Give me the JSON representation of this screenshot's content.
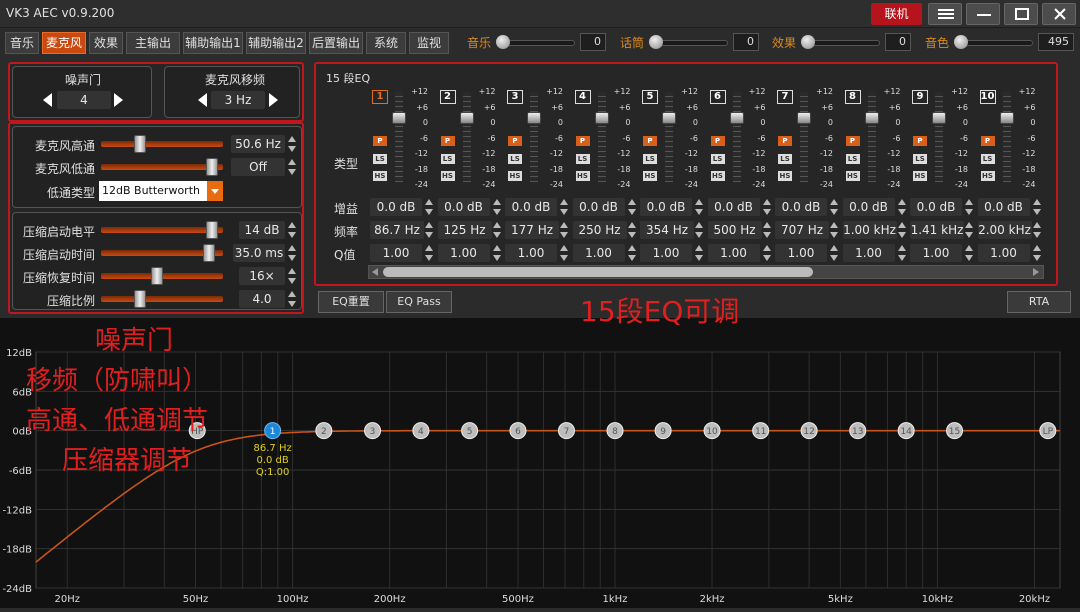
{
  "app": {
    "title": "VK3 AEC v0.9.200",
    "connect_label": "联机"
  },
  "colors": {
    "accent": "#c84a10",
    "annotation": "#e21f1f",
    "curve": "#c8541a",
    "selected_band": "#1e88d8"
  },
  "tabs": [
    "音乐",
    "麦克风",
    "效果",
    "主输出",
    "辅助输出1",
    "辅助输出2",
    "后置输出",
    "系统",
    "监视"
  ],
  "active_tab": "麦克风",
  "mixer": [
    {
      "label": "音乐",
      "value": "0",
      "level": 0
    },
    {
      "label": "话筒",
      "value": "0",
      "level": 0
    },
    {
      "label": "效果",
      "value": "0",
      "level": 0
    },
    {
      "label": "音色",
      "value": "495",
      "level": 0
    }
  ],
  "noise_gate": {
    "label": "噪声门",
    "value": "4"
  },
  "mic_shift": {
    "label": "麦克风移频",
    "value": "3 Hz"
  },
  "filters": {
    "highpass": {
      "label": "麦克风高通",
      "value": "50.6 Hz",
      "level": 0.3
    },
    "lowpass": {
      "label": "麦克风低通",
      "value": "Off",
      "level": 0.95
    },
    "lowpass_type": {
      "label": "低通类型",
      "value": "12dB Butterworth"
    }
  },
  "compressor": [
    {
      "label": "压缩启动电平",
      "value": "14 dB",
      "level": 0.95
    },
    {
      "label": "压缩启动时间",
      "value": "35.0 ms",
      "level": 0.93
    },
    {
      "label": "压缩恢复时间",
      "value": "16×",
      "level": 0.45
    },
    {
      "label": "压缩比例",
      "value": "4.0",
      "level": 0.3
    }
  ],
  "eq": {
    "title": "15 段EQ",
    "type_label": "类型",
    "gain_label": "增益",
    "freq_label": "频率",
    "q_label": "Q值",
    "scale": [
      "+12",
      "+6",
      "0",
      "-6",
      "-12",
      "-18",
      "-24"
    ],
    "type_buttons": [
      "P",
      "LS",
      "HS"
    ],
    "bands": [
      {
        "num": "1",
        "gain": "0.0 dB",
        "freq": "86.7 Hz",
        "q": "1.00"
      },
      {
        "num": "2",
        "gain": "0.0 dB",
        "freq": "125 Hz",
        "q": "1.00"
      },
      {
        "num": "3",
        "gain": "0.0 dB",
        "freq": "177 Hz",
        "q": "1.00"
      },
      {
        "num": "4",
        "gain": "0.0 dB",
        "freq": "250 Hz",
        "q": "1.00"
      },
      {
        "num": "5",
        "gain": "0.0 dB",
        "freq": "354 Hz",
        "q": "1.00"
      },
      {
        "num": "6",
        "gain": "0.0 dB",
        "freq": "500 Hz",
        "q": "1.00"
      },
      {
        "num": "7",
        "gain": "0.0 dB",
        "freq": "707 Hz",
        "q": "1.00"
      },
      {
        "num": "8",
        "gain": "0.0 dB",
        "freq": "1.00 kHz",
        "q": "1.00"
      },
      {
        "num": "9",
        "gain": "0.0 dB",
        "freq": "1.41 kHz",
        "q": "1.00"
      },
      {
        "num": "10",
        "gain": "0.0 dB",
        "freq": "2.00 kHz",
        "q": "1.00"
      }
    ],
    "reset_label": "EQ重置",
    "pass_label": "EQ Pass",
    "rta_label": "RTA"
  },
  "annotations": {
    "eq_note": "15段EQ可调",
    "lines": [
      "噪声门",
      "移频（防啸叫）",
      "高通、低通调节",
      "压缩器调节"
    ]
  },
  "graph": {
    "y_ticks": [
      "12dB",
      "6dB",
      "0dB",
      "-6dB",
      "-12dB",
      "-18dB",
      "-24dB"
    ],
    "x_ticks": [
      "20Hz",
      "50Hz",
      "100Hz",
      "200Hz",
      "500Hz",
      "1kHz",
      "2kHz",
      "5kHz",
      "10kHz",
      "20kHz"
    ],
    "nodes": [
      "HP",
      "1",
      "2",
      "3",
      "4",
      "5",
      "6",
      "7",
      "8",
      "9",
      "10",
      "11",
      "12",
      "13",
      "14",
      "15",
      "LP"
    ],
    "tooltip": [
      "86.7 Hz",
      "0.0 dB",
      "Q:1.00"
    ]
  }
}
